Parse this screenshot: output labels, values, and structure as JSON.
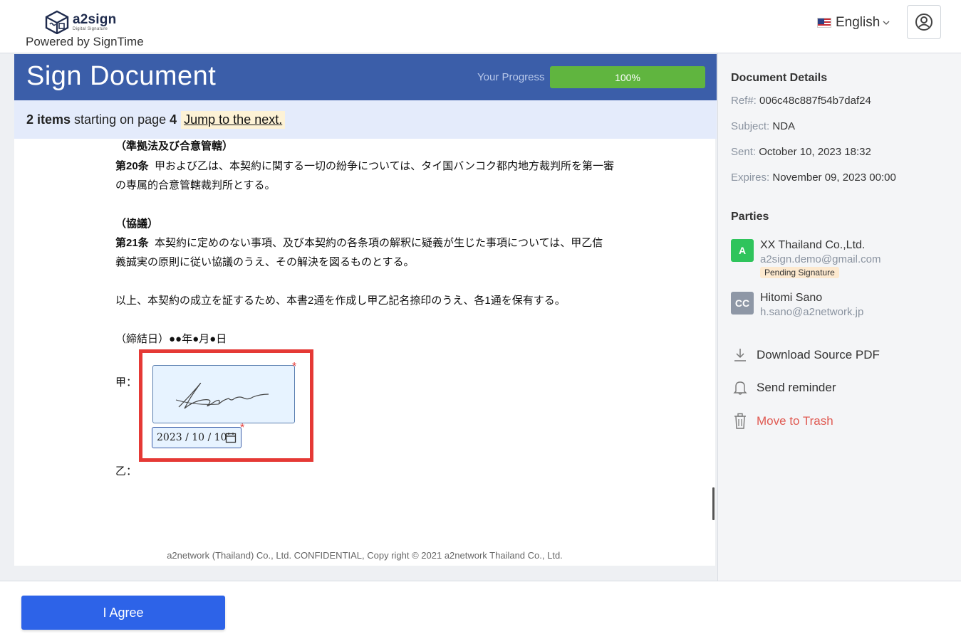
{
  "header": {
    "logo_name": "a2sign",
    "logo_tagline": "Digital Signature",
    "powered_by": "Powered by SignTime",
    "language": "English",
    "language_flag": "us-flag-icon",
    "profile_icon": "user-circle-icon"
  },
  "document": {
    "title": "Sign Document",
    "progress_label": "Your Progress",
    "progress_value": 100,
    "progress_text": "100%",
    "items_count": "2 items",
    "items_text": "starting on page",
    "items_page": "4",
    "jump_label": "Jump to the next.",
    "lines": [
      "（準拠法及び合意管轄）",
      "第20条",
      "甲および乙は、本契約に関する一切の紛争については、タイ国バンコク都内地方裁判所を第一審",
      "の専属的合意管轄裁判所とする。",
      "（協議）",
      "第21条",
      "本契約に定めのない事項、及び本契約の各条項の解釈に疑義が生じた事項については、甲乙信",
      "義誠実の原則に従い協議のうえ、その解決を図るものとする。",
      "以上、本契約の成立を証するため、本書2通を作成し甲乙記名捺印のうえ、各1通を保有する。",
      "（締結日）●●年●月●日",
      "甲：",
      "乙："
    ],
    "required_marker": "*",
    "date_value": "2023 / 10 / 10",
    "footer": "a2network (Thailand) Co., Ltd. CONFIDENTIAL, Copy right © 2021 a2network Thailand Co., Ltd."
  },
  "sidebar": {
    "details_heading": "Document Details",
    "ref_label": "Ref#:",
    "ref_value": "006c48c887f54b7daf24",
    "subject_label": "Subject:",
    "subject_value": "NDA",
    "sent_label": "Sent:",
    "sent_value": "October 10, 2023 18:32",
    "expires_label": "Expires:",
    "expires_value": "November 09, 2023 00:00",
    "parties_heading": "Parties",
    "parties": [
      {
        "initials": "A",
        "name": "XX Thailand Co.,Ltd.",
        "email": "a2sign.demo@gmail.com",
        "status": "Pending Signature",
        "color": "#2fc45c"
      },
      {
        "initials": "CC",
        "name": "Hitomi Sano",
        "email": "h.sano@a2network.jp",
        "color": "#8e97a6"
      }
    ],
    "actions": {
      "download": "Download Source PDF",
      "reminder": "Send reminder",
      "trash": "Move to Trash"
    }
  },
  "footer": {
    "agree_label": "I Agree"
  },
  "colors": {
    "header_blue": "#3b5ea9",
    "progress_green": "#60b53f",
    "agree_blue": "#2d63e8",
    "highlight_red": "#e53935",
    "danger_text": "#e05a52"
  }
}
